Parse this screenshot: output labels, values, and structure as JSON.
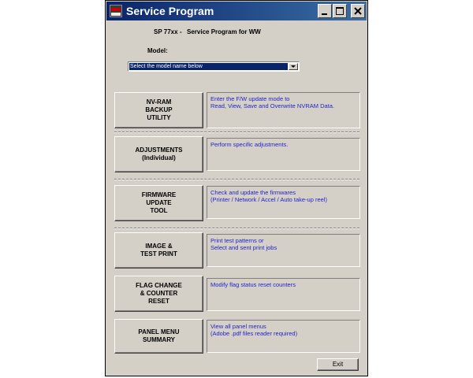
{
  "window": {
    "title": "Service Program"
  },
  "header": {
    "product": "SP 77xx",
    "dash": "-",
    "subtitle": "Service Program for WW"
  },
  "model": {
    "label": "Model:",
    "selected": "Select the model name below"
  },
  "functions": [
    {
      "label": "NV-RAM\nBACKUP\nUTILITY",
      "desc": "Enter the F/W update mode to\nRead, View, Save and Overwrite NVRAM Data."
    },
    {
      "label": "ADJUSTMENTS\n(Individual)",
      "desc": "Perform specific adjustments."
    },
    {
      "label": "FIRMWARE\nUPDATE\nTOOL",
      "desc": "Check and update the firmwares\n(Printer / Network / Accel / Auto take-up reel)"
    },
    {
      "label": "IMAGE &\nTEST PRINT",
      "desc": "Print test patterns or\nSelect and sent print jobs"
    },
    {
      "label": "FLAG CHANGE\n& COUNTER\nRESET",
      "desc": "Modify flag status  reset counters"
    },
    {
      "label": "PANEL MENU\nSUMMARY",
      "desc": "View all panel menus\n(Adobe .pdf files reader required)"
    }
  ],
  "footer": {
    "exit_label": "Exit"
  },
  "colors": {
    "titlebar": "#0a246a",
    "face": "#d4d0c8",
    "desc_text": "#2323c8"
  }
}
